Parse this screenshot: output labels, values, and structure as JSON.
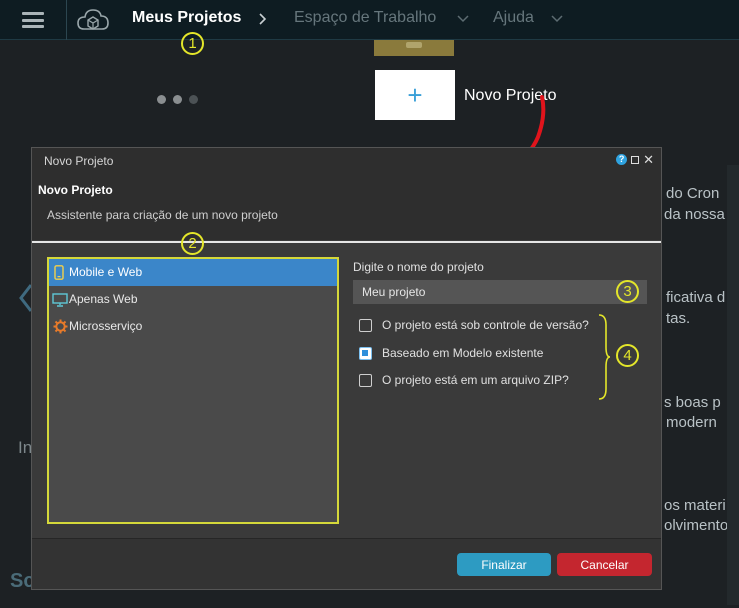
{
  "nav": {
    "projects": "Meus Projetos",
    "workspace": "Espaço de Trabalho",
    "help": "Ajuda"
  },
  "background": {
    "new_tile_plus": "+",
    "new_project_label": "Novo Projeto",
    "text_lines": [
      "do Cron",
      "da nossa",
      "ficativa d",
      "tas.",
      "s boas p",
      "modern",
      "os materi",
      "olvimento."
    ],
    "left_text": "In",
    "bottom_text": "Sc"
  },
  "annotations": [
    "1",
    "2",
    "3",
    "4"
  ],
  "dialog": {
    "window_title": "Novo Projeto",
    "header_title": "Novo Projeto",
    "header_subtitle": "Assistente para criação de um novo projeto",
    "project_types": [
      {
        "label": "Mobile e Web",
        "icon": "mobile-icon",
        "selected": true
      },
      {
        "label": "Apenas Web",
        "icon": "monitor-icon",
        "selected": false
      },
      {
        "label": "Microsserviço",
        "icon": "gear-icon",
        "selected": false
      }
    ],
    "name_label": "Digite o nome do projeto",
    "name_value": "Meu projeto",
    "options": [
      {
        "label": "O projeto está sob controle de versão?",
        "checked": false
      },
      {
        "label": "Baseado em Modelo existente",
        "checked": true
      },
      {
        "label": "O projeto está em um arquivo ZIP?",
        "checked": false
      }
    ],
    "finish_label": "Finalizar",
    "cancel_label": "Cancelar"
  },
  "colors": {
    "accent_blue": "#3b86c9",
    "finish_button": "#2d9bc2",
    "cancel_button": "#c4262f",
    "annotation": "#e4e62a",
    "arrow": "#e0141c"
  }
}
